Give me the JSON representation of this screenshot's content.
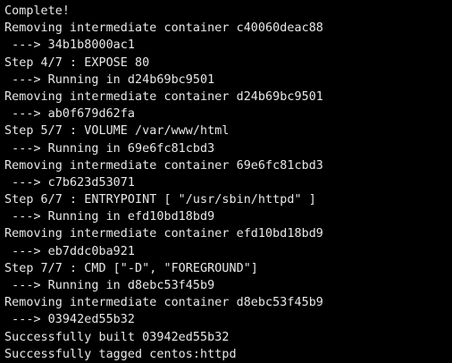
{
  "terminal": {
    "lines": [
      "Complete!",
      "Removing intermediate container c40060deac88",
      " ---> 34b1b8000ac1",
      "Step 4/7 : EXPOSE 80",
      " ---> Running in d24b69bc9501",
      "Removing intermediate container d24b69bc9501",
      " ---> ab0f679d62fa",
      "Step 5/7 : VOLUME /var/www/html",
      " ---> Running in 69e6fc81cbd3",
      "Removing intermediate container 69e6fc81cbd3",
      " ---> c7b623d53071",
      "Step 6/7 : ENTRYPOINT [ \"/usr/sbin/httpd\" ]",
      " ---> Running in efd10bd18bd9",
      "Removing intermediate container efd10bd18bd9",
      " ---> eb7ddc0ba921",
      "Step 7/7 : CMD [\"-D\", \"FOREGROUND\"]",
      " ---> Running in d8ebc53f45b9",
      "Removing intermediate container d8ebc53f45b9",
      " ---> 03942ed55b32",
      "Successfully built 03942ed55b32",
      "Successfully tagged centos:httpd"
    ]
  }
}
